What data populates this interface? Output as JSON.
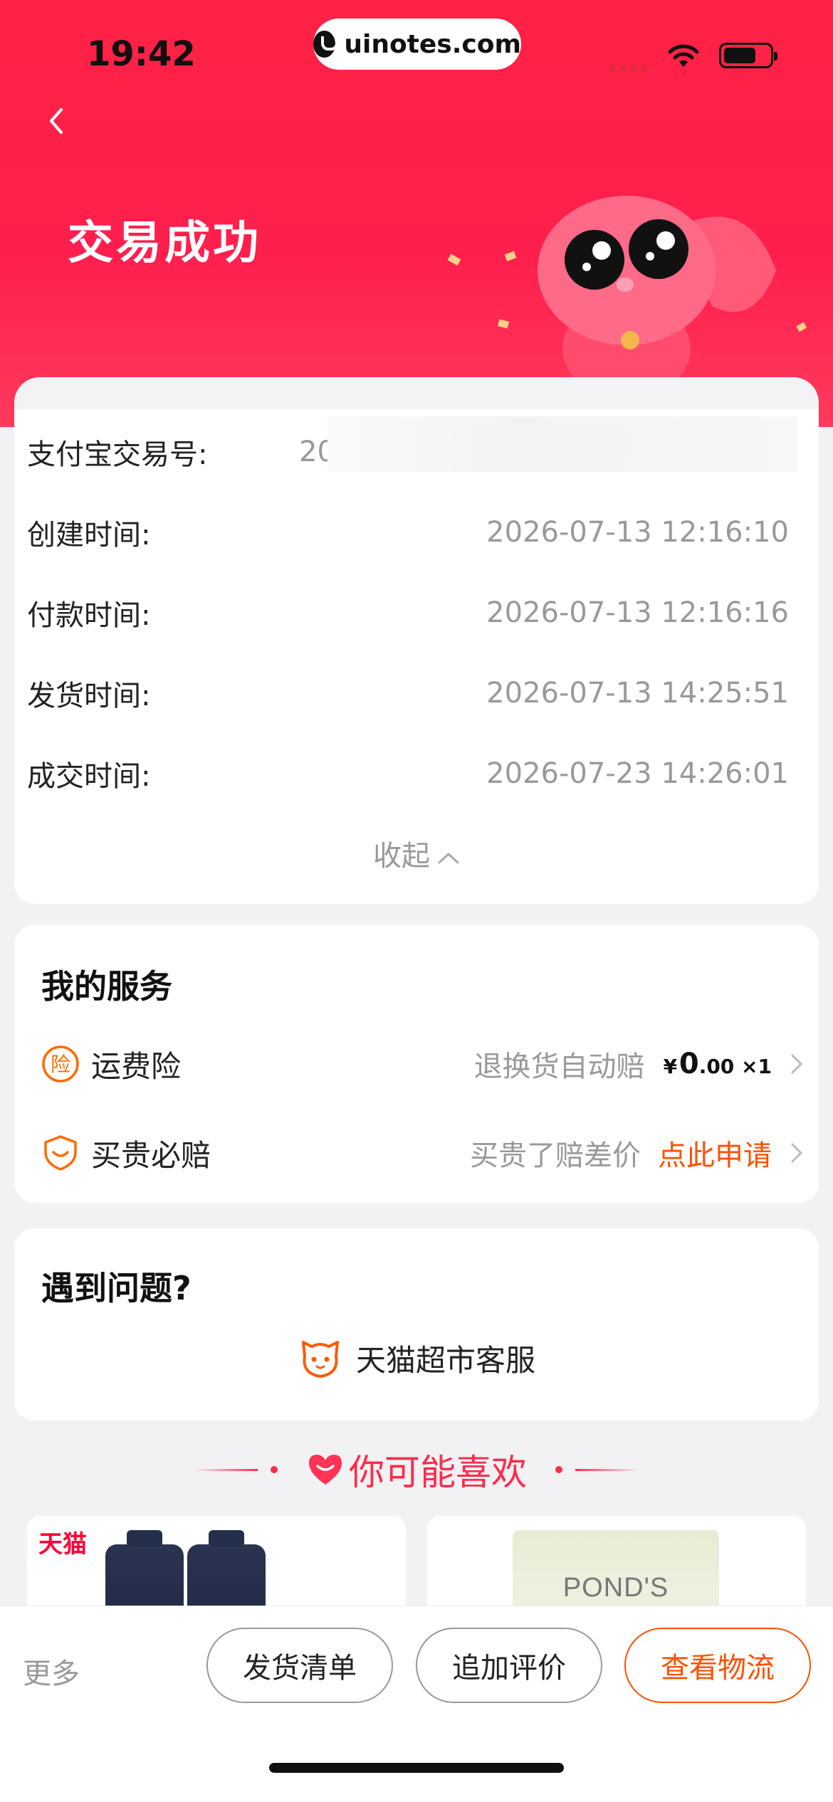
{
  "status_bar": {
    "time": "19:42",
    "url": "uinotes.com"
  },
  "header": {
    "title": "交易成功"
  },
  "order": {
    "rows": [
      {
        "label": "支付宝交易号:",
        "value": "202"
      },
      {
        "label": "创建时间:",
        "value": "2026-07-13 12:16:10"
      },
      {
        "label": "付款时间:",
        "value": "2026-07-13 12:16:16"
      },
      {
        "label": "发货时间:",
        "value": "2026-07-13 14:25:51"
      },
      {
        "label": "成交时间:",
        "value": "2026-07-23 14:26:01"
      }
    ],
    "collapse_label": "收起"
  },
  "services": {
    "title": "我的服务",
    "items": [
      {
        "label": "运费险",
        "desc": "退换货自动赔",
        "currency": "¥",
        "amount_int": "0",
        "amount_dec": ".00",
        "qty": "×1"
      },
      {
        "label": "买贵必赔",
        "desc": "买贵了赔差价",
        "link": "点此申请"
      }
    ]
  },
  "help": {
    "title": "遇到问题?",
    "service_label": "天猫超市客服"
  },
  "recommend": {
    "title": "你可能喜欢",
    "products": [
      {
        "tag": "天猫"
      },
      {
        "brand": "POND'S POND'S"
      }
    ]
  },
  "bottom_bar": {
    "more": "更多",
    "buttons": [
      "发货清单",
      "追加评价",
      "查看物流"
    ]
  },
  "colors": {
    "header": "#ff2244",
    "accent": "#ff5000",
    "recommend": "#ff2b4a"
  }
}
